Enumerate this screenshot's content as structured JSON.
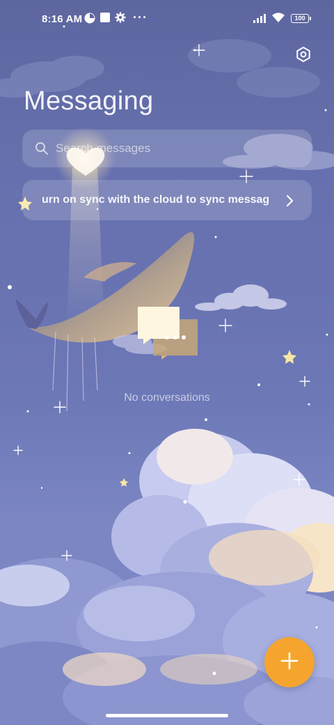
{
  "status_bar": {
    "time": "8:16 AM",
    "battery": "100",
    "icons": [
      "data-saver-icon",
      "notification-square-icon",
      "gear-icon",
      "more-dots-icon",
      "signal-icon",
      "wifi-icon",
      "battery-icon"
    ],
    "overflow": "···"
  },
  "header": {
    "title": "Messaging",
    "settings_icon": "hexagon-settings-icon"
  },
  "search": {
    "placeholder": "Search messages",
    "icon": "search-icon"
  },
  "sync_banner": {
    "text": "urn on sync with the cloud to sync messag",
    "icon": "chevron-right-icon"
  },
  "empty_state": {
    "icon": "chat-bubbles-icon",
    "text": "No conversations"
  },
  "fab": {
    "icon": "plus-icon",
    "color": "#f5a52d"
  },
  "colors": {
    "accent": "#f5a52d",
    "bubble_front": "#fff6df",
    "bubble_back": "#f3c86a"
  }
}
